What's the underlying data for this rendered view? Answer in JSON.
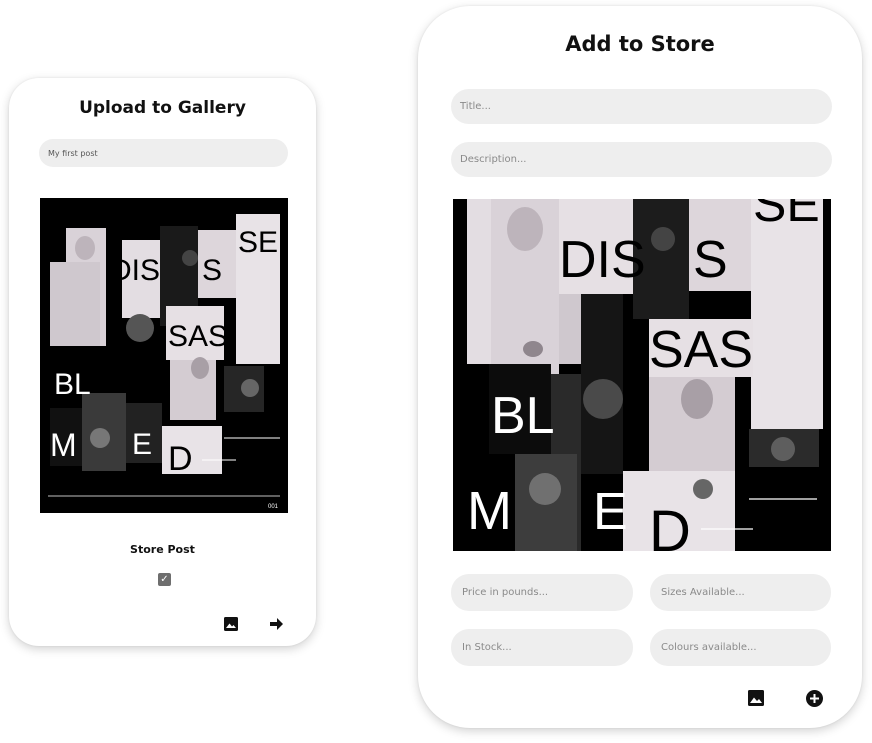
{
  "gallery": {
    "title": "Upload to Gallery",
    "post_title_value": "My first post",
    "artwork_caption": "001",
    "store_post_label": "Store Post",
    "store_post_checked": true,
    "image_icon": "image-icon",
    "submit_icon": "arrow-right-icon"
  },
  "store": {
    "title": "Add to Store",
    "title_placeholder": "Title...",
    "description_placeholder": "Description...",
    "price_placeholder": "Price in pounds...",
    "sizes_placeholder": "Sizes Available...",
    "stock_placeholder": "In Stock...",
    "colours_placeholder": "Colours available...",
    "image_icon": "image-icon",
    "add_icon": "add-circle-icon"
  },
  "artwork_letters": [
    "DIS",
    "S",
    "SE",
    "SAS",
    "BL",
    "M",
    "E",
    "D"
  ],
  "colors": {
    "pill_bg": "#eeeeee",
    "placeholder": "#8a8a8a",
    "card_bg": "#ffffff",
    "artwork_bg": "#000000"
  }
}
